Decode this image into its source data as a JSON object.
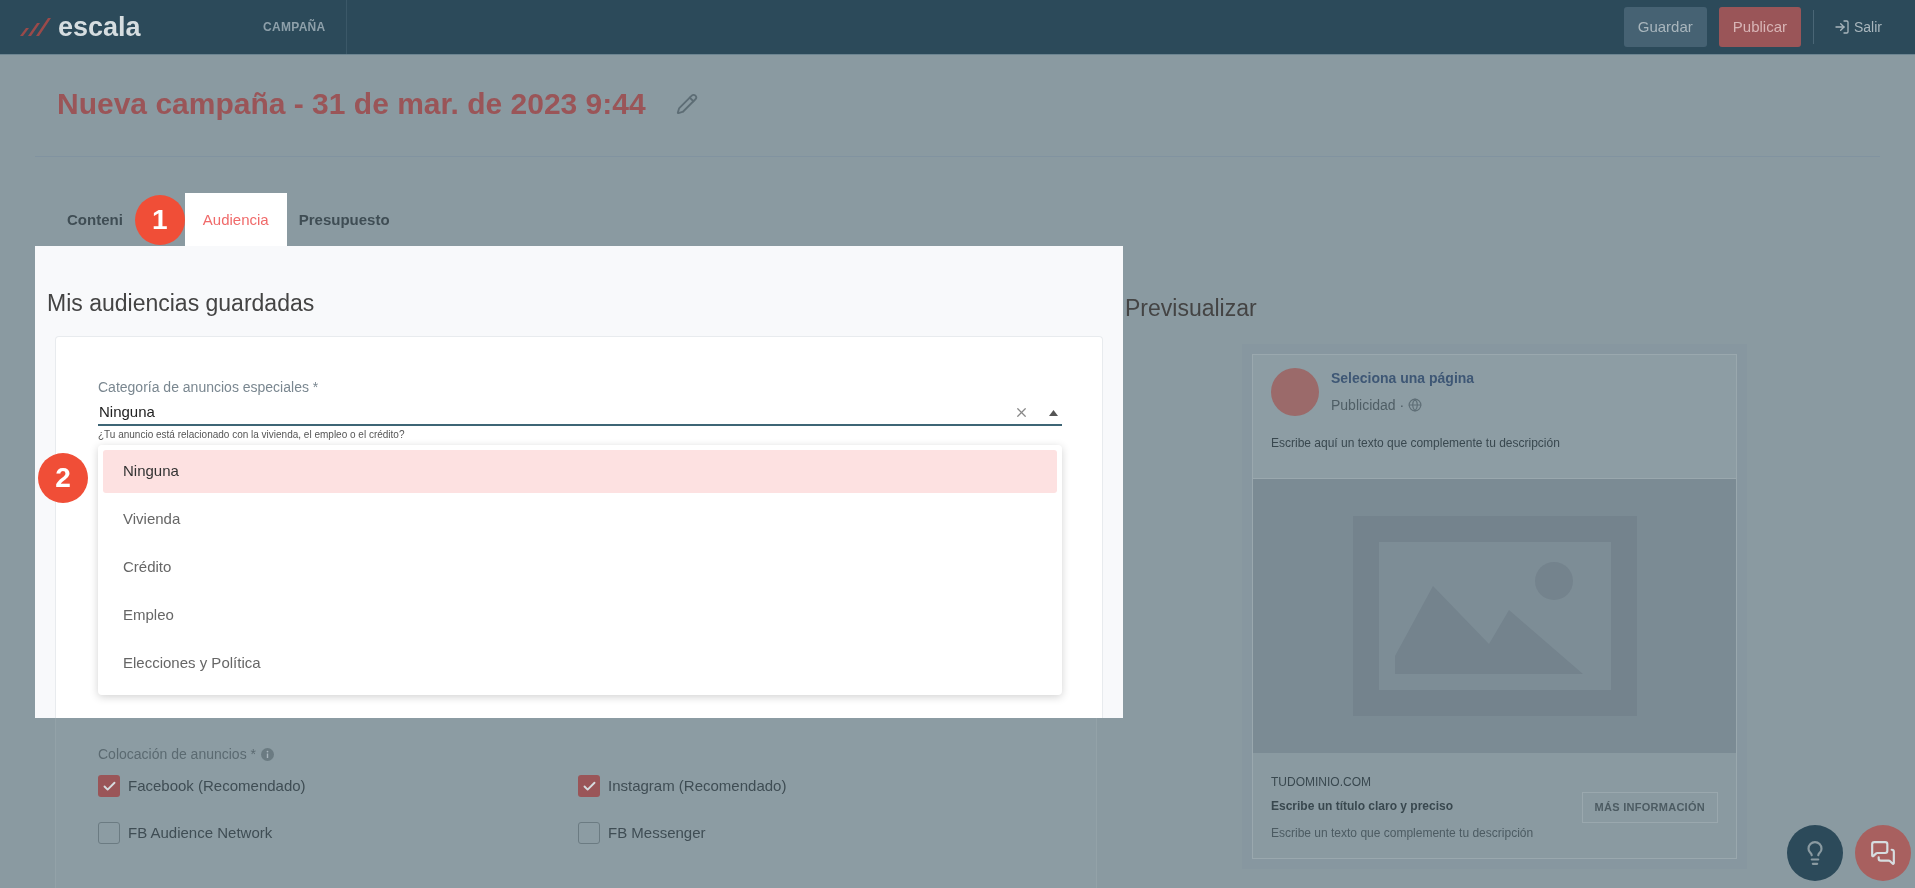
{
  "topbar": {
    "logo": "escala",
    "section": "CAMPAÑA",
    "buttons": [
      {
        "label": "Guardar",
        "kind": "secondary"
      },
      {
        "label": "Publicar",
        "kind": "primary"
      }
    ],
    "exit": "Salir"
  },
  "title": "Nueva campaña - 31 de mar. de 2023 9:44",
  "tabs": [
    {
      "label": "Conteni",
      "selected": false
    },
    {
      "label": "Audiencia",
      "selected": true
    },
    {
      "label": "Presupuesto",
      "selected": false
    }
  ],
  "annotations": [
    "1",
    "2"
  ],
  "audiences": {
    "heading": "Mis audiencias guardadas",
    "field": {
      "label": "Categoría de anuncios especiales *",
      "value": "Ninguna",
      "helper": "¿Tu anuncio está relacionado con la vivienda, el empleo o el crédito?",
      "expanded": true
    },
    "options": [
      {
        "label": "Ninguna",
        "selected": true
      },
      {
        "label": "Vivienda",
        "selected": false
      },
      {
        "label": "Crédito",
        "selected": false
      },
      {
        "label": "Empleo",
        "selected": false
      },
      {
        "label": "Elecciones y Política",
        "selected": false
      }
    ]
  },
  "placement": {
    "label": "Colocación de anuncios *",
    "options": [
      {
        "label": "Facebook (Recomendado)",
        "checked": true
      },
      {
        "label": "Instagram (Recomendado)",
        "checked": true
      },
      {
        "label": "FB Audience Network",
        "checked": false
      },
      {
        "label": "FB Messenger",
        "checked": false
      }
    ]
  },
  "preview": {
    "heading": "Previsualizar",
    "page_name": "Seleciona una página",
    "sponsored": "Publicidad ·",
    "body": "Escribe aquí un texto que complemente tu descripción",
    "domain": "TUDOMINIO.COM",
    "headline": "Escribe un título claro y preciso",
    "description": "Escribe un texto que complemente tu descripción",
    "cta": "MÁS INFORMACIÓN"
  }
}
